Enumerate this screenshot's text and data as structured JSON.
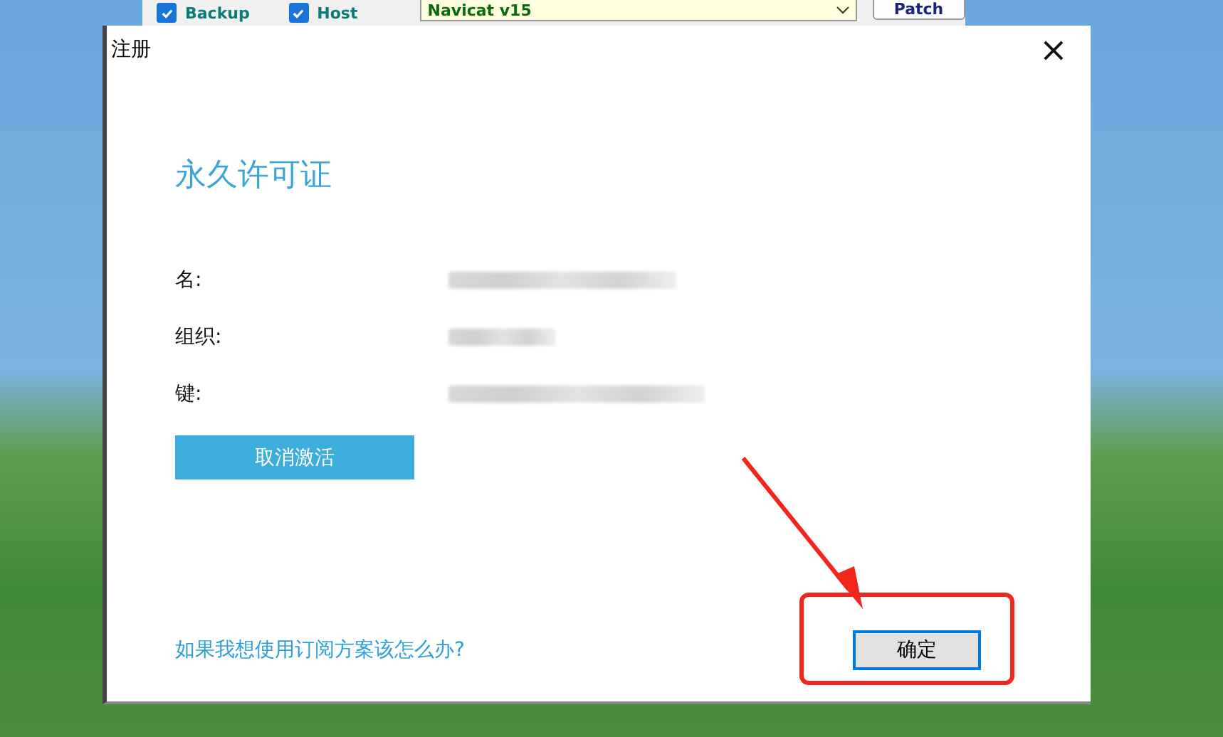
{
  "background_app": {
    "options": [
      {
        "label": "Backup",
        "checked": true
      },
      {
        "label": "Host",
        "checked": true
      }
    ],
    "product_select": {
      "value": "Navicat v15"
    },
    "patch_button": "Patch"
  },
  "dialog": {
    "title": "注册",
    "close": "×",
    "heading": "永久许可证",
    "fields": [
      {
        "label": "名:"
      },
      {
        "label": "组织:"
      },
      {
        "label": "键:"
      }
    ],
    "deactivate_button": "取消激活",
    "subscription_link": "如果我想使用订阅方案该怎么办?",
    "ok_button": "确定"
  }
}
